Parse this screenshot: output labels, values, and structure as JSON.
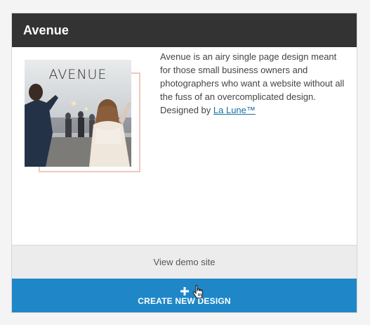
{
  "card": {
    "title": "Avenue",
    "thumbnail": {
      "overlay_title": "AVENUE",
      "accent_color": "#f2c6c0"
    },
    "description": {
      "text": "Avenue is an airy single page design meant for those small business owners and photographers who want a website without all the fuss of an overcomplicated design. Designed by ",
      "credit_link": "La Lune™"
    },
    "view_demo_label": "View demo site",
    "create_label": "CREATE NEW DESIGN"
  },
  "icons": {
    "create": "plus-icon",
    "cursor": "hand-pointer-icon"
  },
  "colors": {
    "header_bg": "#333333",
    "create_button_bg": "#1f87c8",
    "demo_bar_bg": "#ececec",
    "link": "#1a6fa8"
  }
}
